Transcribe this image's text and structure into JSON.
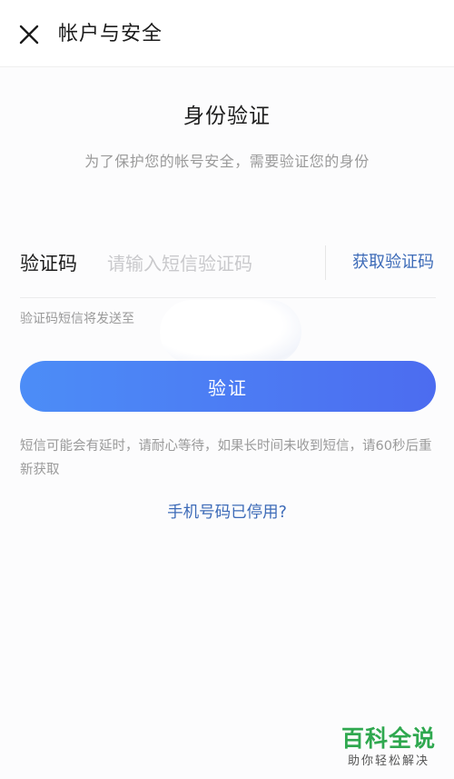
{
  "header": {
    "title": "帐户与安全",
    "close_icon": "close-icon"
  },
  "verify": {
    "title": "身份验证",
    "subtitle": "为了保护您的帐号安全，需要验证您的身份"
  },
  "code_field": {
    "label": "验证码",
    "placeholder": "请输入短信验证码",
    "value": "",
    "get_code_label": "获取验证码"
  },
  "send_note": "验证码短信将发送至",
  "verify_button": {
    "label": "验证",
    "color_start": "#4c8df7",
    "color_end": "#4c6cf0"
  },
  "delay_note": "短信可能会有延时，请耐心等待，如果长时间未收到短信，请60秒后重新获取",
  "phone_disabled_link": "手机号码已停用?",
  "watermark": {
    "title": "百科全说",
    "subtitle": "助你轻松解决"
  },
  "colors": {
    "link": "#3d6bb8",
    "muted_text": "#9a9a9a",
    "watermark_green": "#2fa84f"
  }
}
